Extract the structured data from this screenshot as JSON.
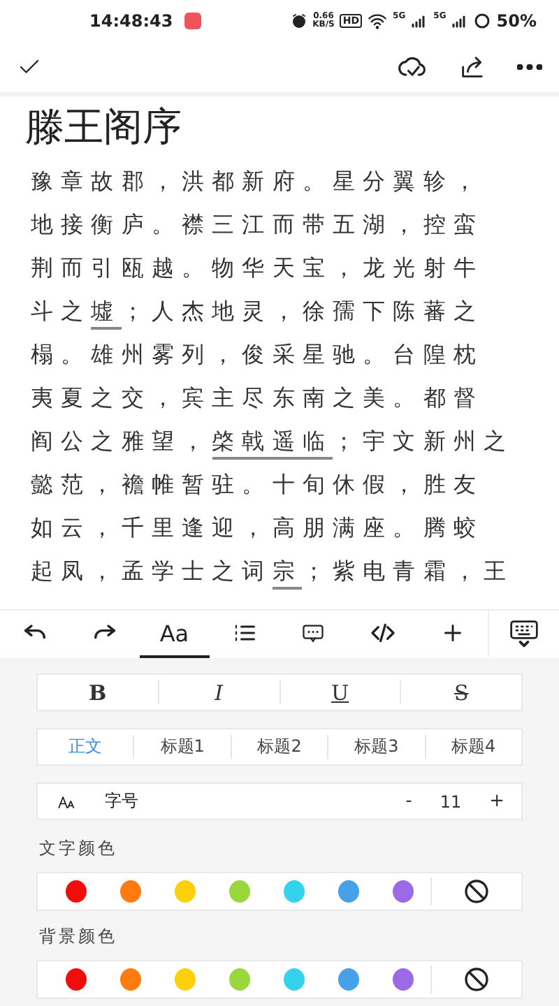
{
  "status_bar": {
    "time": "14:48:43",
    "net_speed": "0.66",
    "net_unit": "KB/S",
    "hd": "HD",
    "sim_1": "5G",
    "sim_2": "5G",
    "battery": "50%"
  },
  "document": {
    "title": "滕王阁序",
    "lines": [
      [
        {
          "text": "豫章故郡，洪都新府。星分翼轸，",
          "underlined": false
        }
      ],
      [
        {
          "text": "地接衡庐。襟三江而带五湖，控蛮",
          "underlined": false
        }
      ],
      [
        {
          "text": "荆而引瓯越。物华天宝，龙光射牛",
          "underlined": false
        }
      ],
      [
        {
          "text": "斗之",
          "underlined": false
        },
        {
          "text": "墟",
          "underlined": true
        },
        {
          "text": "；人杰地灵，徐孺下陈蕃之",
          "underlined": false
        }
      ],
      [
        {
          "text": "榻。雄州雾列，俊采星驰。台隍枕",
          "underlined": false
        }
      ],
      [
        {
          "text": "夷夏之交，宾主尽东南之美。都督",
          "underlined": false
        }
      ],
      [
        {
          "text": "阎公之雅望，",
          "underlined": false
        },
        {
          "text": "棨戟遥临",
          "underlined": true
        },
        {
          "text": "；宇文新州之",
          "underlined": false
        }
      ],
      [
        {
          "text": "懿范，襜帷暂驻。十旬休假，胜友",
          "underlined": false
        }
      ],
      [
        {
          "text": "如云，千里逢迎，高朋满座。腾蛟",
          "underlined": false
        }
      ],
      [
        {
          "text": "起凤，孟学士之词",
          "underlined": false
        },
        {
          "text": "宗",
          "underlined": true
        },
        {
          "text": "；紫电青霜，王",
          "underlined": false
        }
      ]
    ]
  },
  "toolbar": [
    {
      "kind": "undo",
      "selected": false
    },
    {
      "kind": "redo",
      "selected": false
    },
    {
      "kind": "text",
      "label": "Aa",
      "selected": true
    },
    {
      "kind": "list",
      "selected": false
    },
    {
      "kind": "comment",
      "selected": false
    },
    {
      "kind": "code",
      "selected": false
    },
    {
      "kind": "plus",
      "selected": false
    },
    {
      "kind": "keyboard",
      "selected": false
    }
  ],
  "format_buttons": [
    {
      "kind": "bold",
      "label": "B"
    },
    {
      "kind": "italic",
      "label": "I"
    },
    {
      "kind": "underline",
      "label": "U"
    },
    {
      "kind": "strike",
      "label": "S"
    }
  ],
  "paragraph_styles": [
    {
      "label": "正文",
      "selected": true
    },
    {
      "label": "标题1",
      "selected": false
    },
    {
      "label": "标题2",
      "selected": false
    },
    {
      "label": "标题3",
      "selected": false
    },
    {
      "label": "标题4",
      "selected": false
    }
  ],
  "font_size": {
    "label": "字号",
    "decrease": "-",
    "value": "11",
    "increase": "+"
  },
  "text_color": {
    "label": "文字颜色",
    "colors": [
      {
        "color": "#f20d0d"
      },
      {
        "color": "#ff7a0f"
      },
      {
        "color": "#fcd00b"
      },
      {
        "color": "#9ad73c"
      },
      {
        "color": "#33d3ee"
      },
      {
        "color": "#47a1ea"
      },
      {
        "color": "#9b6ae6"
      }
    ]
  },
  "background_color": {
    "label": "背景颜色",
    "colors": [
      {
        "color": "#f20d0d"
      },
      {
        "color": "#ff7a0f"
      },
      {
        "color": "#fcd00b"
      },
      {
        "color": "#9ad73c"
      },
      {
        "color": "#33d3ee"
      },
      {
        "color": "#47a1ea"
      },
      {
        "color": "#9b6ae6"
      }
    ]
  }
}
